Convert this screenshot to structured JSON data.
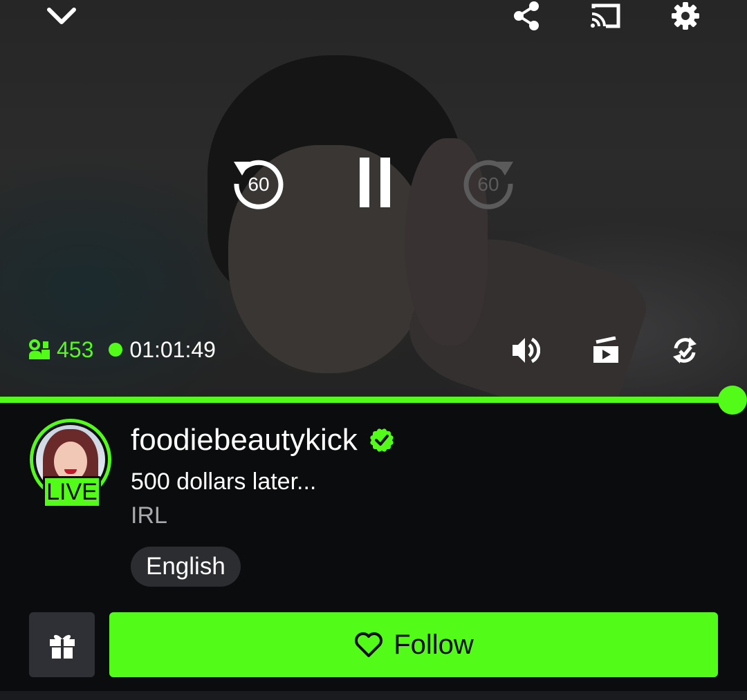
{
  "player": {
    "viewers": "453",
    "uptime": "01:01:49",
    "rewind_seconds": "60",
    "forward_seconds": "60",
    "progress_fraction": 1.0
  },
  "channel": {
    "username": "foodiebeautykick",
    "live_badge": "LIVE",
    "stream_title": "500 dollars later...",
    "category": "IRL",
    "language": "English"
  },
  "actions": {
    "follow_label": "Follow"
  },
  "colors": {
    "accent": "#53fc18",
    "background": "#0b0c0e",
    "tag_background": "#2b2d31",
    "muted_text": "#a7a9ad"
  },
  "icons": [
    "chevron-down-icon",
    "share-icon",
    "cast-icon",
    "settings-icon",
    "rewind-icon",
    "pause-icon",
    "forward-icon",
    "viewers-icon",
    "volume-icon",
    "mini-player-icon",
    "rotate-icon",
    "verified-icon",
    "gift-icon",
    "heart-icon"
  ]
}
